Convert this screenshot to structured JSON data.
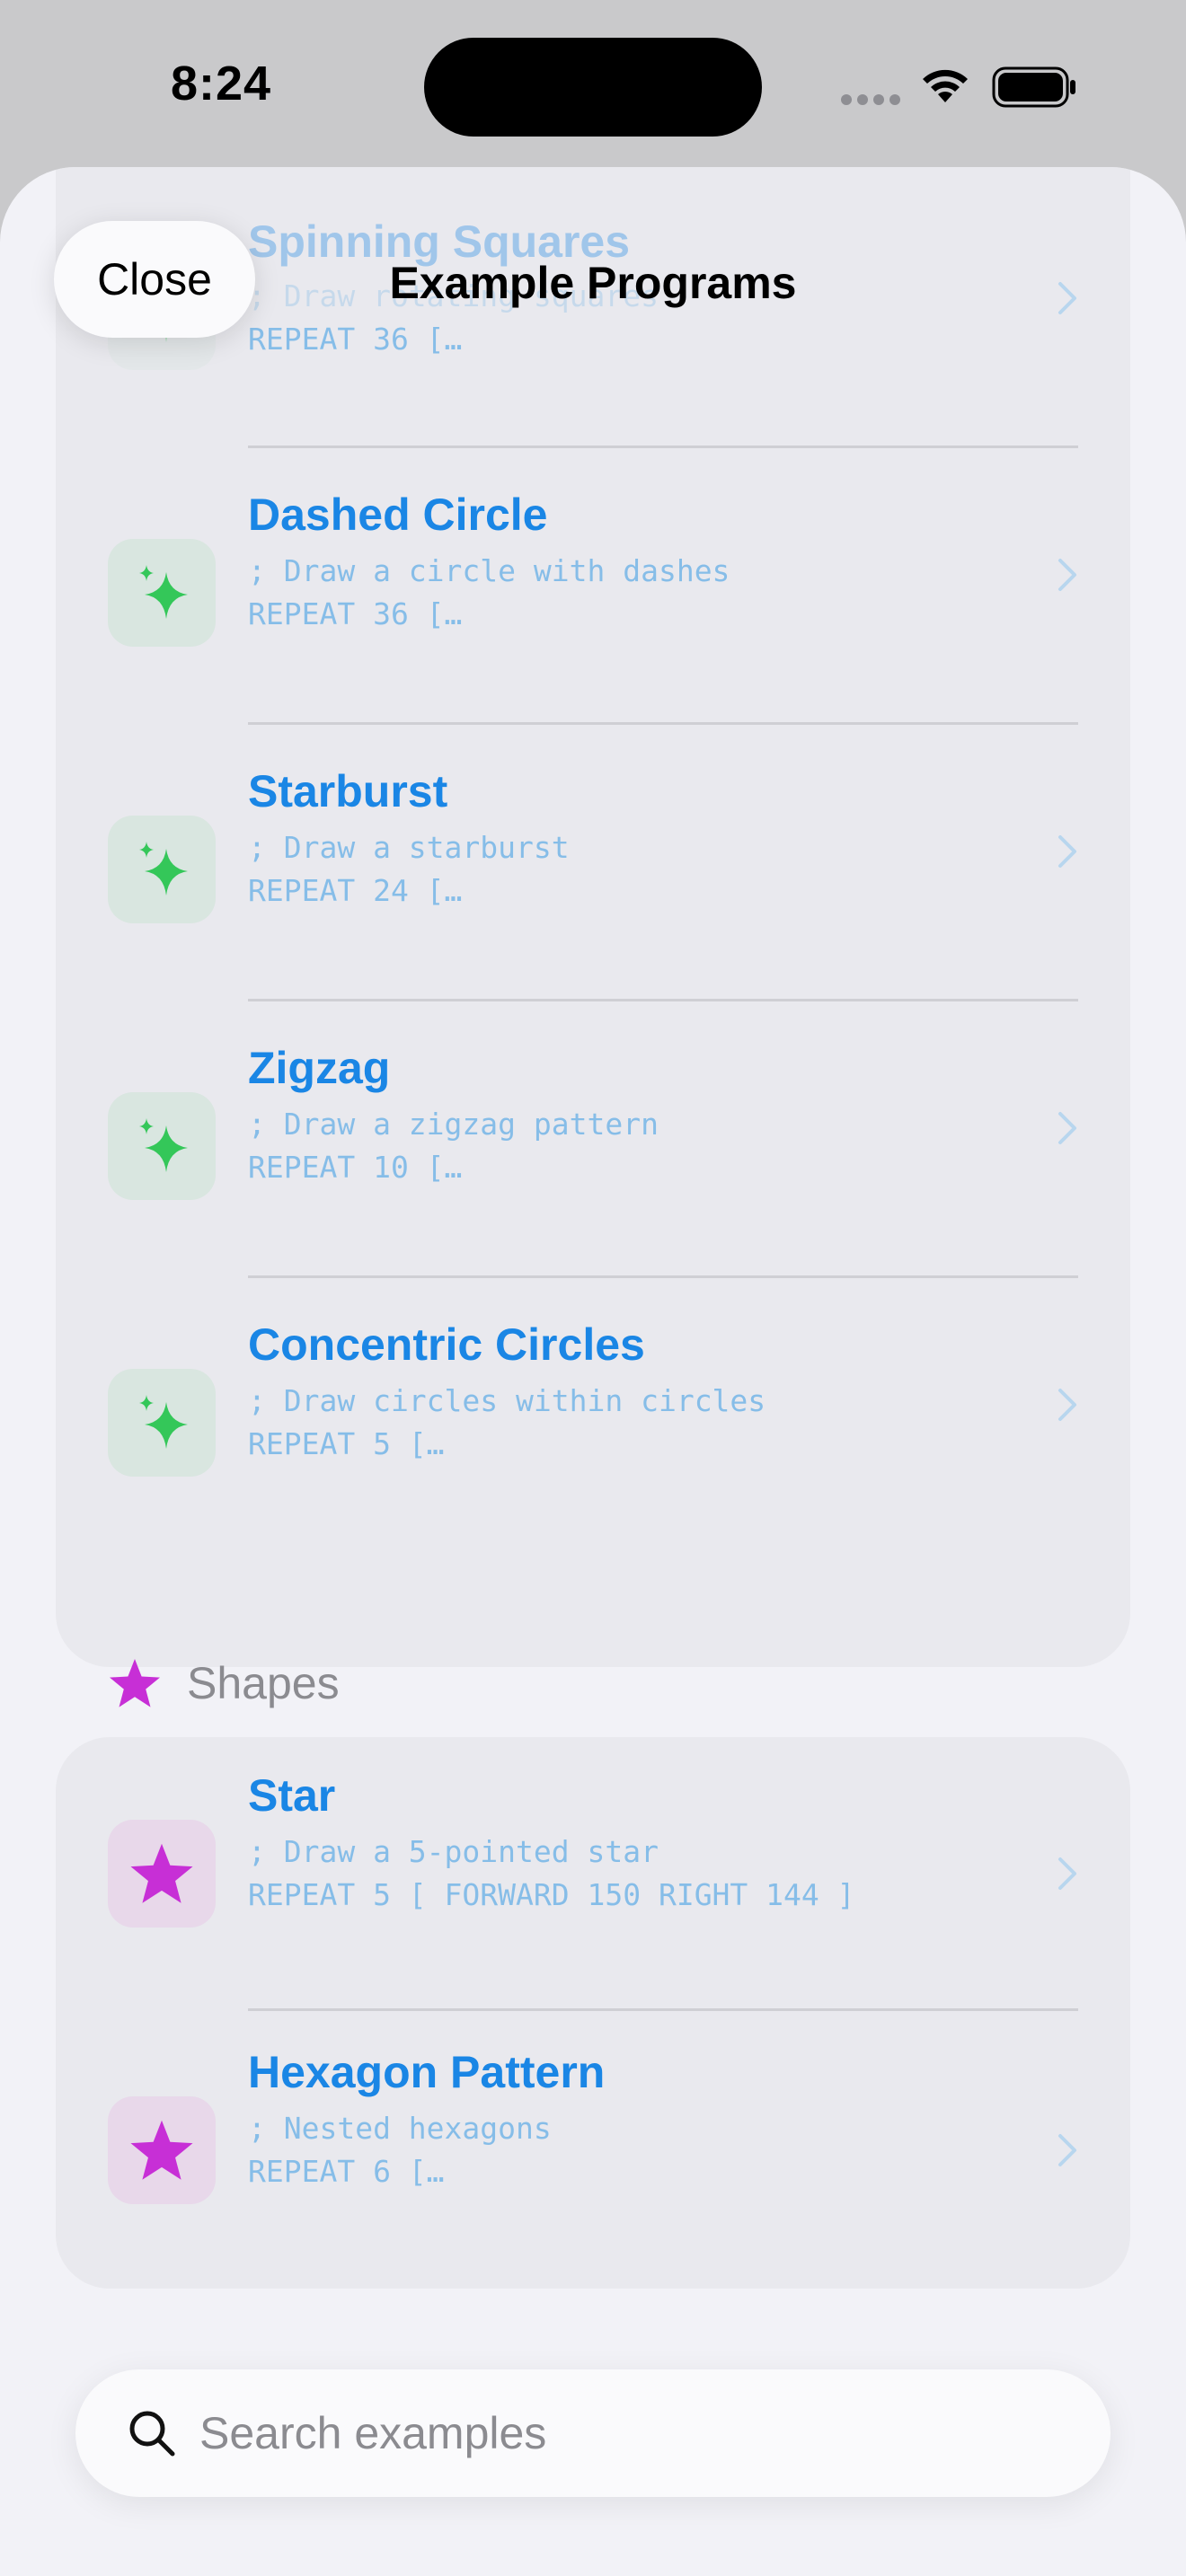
{
  "status_bar": {
    "time": "8:24"
  },
  "header": {
    "close_label": "Close",
    "title": "Example Programs"
  },
  "group1": [
    {
      "title": "Spinning Squares",
      "code1": "; Draw rotating squares",
      "code2": "REPEAT 36 […",
      "icon": "sparkles-icon"
    },
    {
      "title": "Dashed Circle",
      "code1": "; Draw a circle with dashes",
      "code2": "REPEAT 36 […",
      "icon": "sparkles-icon"
    },
    {
      "title": "Starburst",
      "code1": "; Draw a starburst",
      "code2": "REPEAT 24 […",
      "icon": "sparkles-icon"
    },
    {
      "title": "Zigzag",
      "code1": "; Draw a zigzag pattern",
      "code2": "REPEAT 10 […",
      "icon": "sparkles-icon"
    },
    {
      "title": "Concentric Circles",
      "code1": "; Draw circles within circles",
      "code2": "REPEAT 5 […",
      "icon": "sparkles-icon"
    }
  ],
  "section_shapes": {
    "label": "Shapes",
    "icon": "star-icon"
  },
  "group2": [
    {
      "title": "Star",
      "code1": "; Draw a 5-pointed star",
      "code2": "REPEAT 5 [ FORWARD 150 RIGHT 144 ]",
      "icon": "star-icon"
    },
    {
      "title": "Hexagon Pattern",
      "code1": "; Nested hexagons",
      "code2": "REPEAT 6 […",
      "icon": "star-icon"
    }
  ],
  "search": {
    "placeholder": "Search examples"
  },
  "colors": {
    "accent": "#1a86e5",
    "green": "#34c759",
    "purple": "#c72fd6"
  }
}
